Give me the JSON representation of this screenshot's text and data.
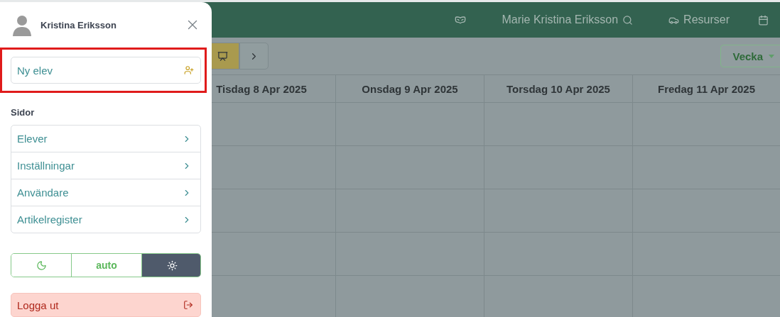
{
  "app_header": {
    "user_name": "Marie Kristina Eriksson",
    "resources_label": "Resurser"
  },
  "toolbar": {
    "view_select": "Vecka"
  },
  "calendar": {
    "columns": [
      "Tisdag 8 Apr 2025",
      "Onsdag 9 Apr 2025",
      "Torsdag 10 Apr 2025",
      "Fredag 11 Apr 2025"
    ]
  },
  "drawer": {
    "user_name": "Kristina Eriksson",
    "new_student": {
      "placeholder": "Ny elev",
      "highlighted": true
    },
    "section_title": "Sidor",
    "pages": [
      {
        "label": "Elever"
      },
      {
        "label": "Inställningar"
      },
      {
        "label": "Användare"
      },
      {
        "label": "Artikelregister"
      }
    ],
    "theme_options": [
      {
        "kind": "dark",
        "selected": false
      },
      {
        "kind": "auto",
        "label": "auto",
        "selected": false
      },
      {
        "kind": "light",
        "selected": true
      }
    ],
    "logout": "Logga ut"
  }
}
